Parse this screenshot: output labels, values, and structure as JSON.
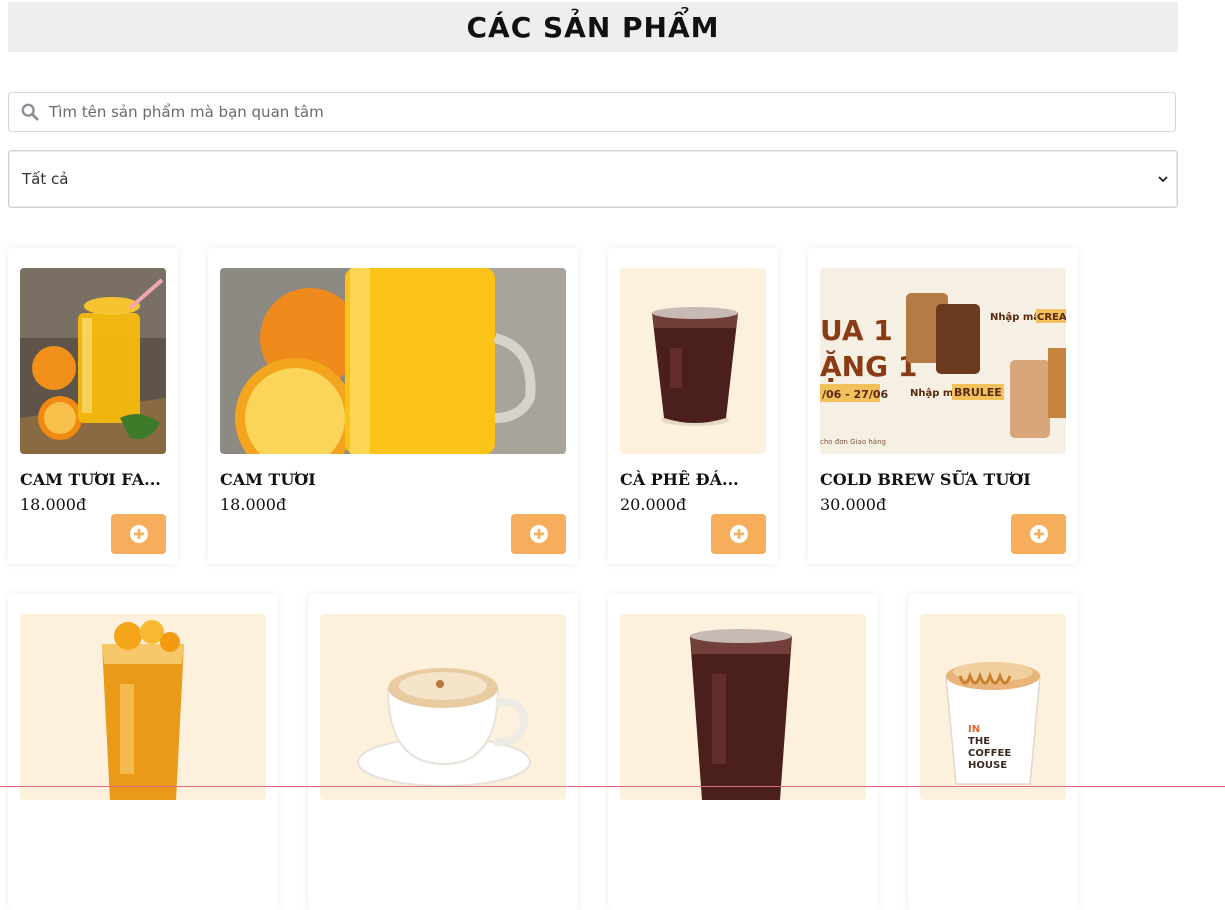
{
  "header": {
    "title": "CÁC SẢN PHẨM"
  },
  "search": {
    "placeholder": "Tìm tên sản phẩm mà bạn quan tâm",
    "icon": "search-icon"
  },
  "filter": {
    "selected": "Tất cả",
    "icon": "chevron-down-icon"
  },
  "colors": {
    "accent": "#f6ae5c",
    "title_bg": "#eeeeee",
    "image_bg": "#fdf0dc"
  },
  "products": [
    {
      "name": "CAM TƯƠI FA...",
      "price": "18.000đ"
    },
    {
      "name": "CAM TƯƠI",
      "price": "18.000đ"
    },
    {
      "name": "CÀ PHÊ ĐÁ...",
      "price": "20.000đ"
    },
    {
      "name": "COLD BREW SỮA TƯƠI",
      "price": "30.000đ"
    },
    {
      "name": "",
      "price": ""
    },
    {
      "name": "",
      "price": ""
    },
    {
      "name": "",
      "price": ""
    },
    {
      "name": "",
      "price": ""
    }
  ],
  "promo_image_text": {
    "line1": "UA 1",
    "line2": "ẶNG 1",
    "dates": "/06 - 27/06",
    "code_label_1": "Nhập mã:",
    "code_1": "CREA",
    "code_label_2": "Nhập mã:",
    "code_2": "BRULEE",
    "footnote": "cho đơn Giao hàng"
  },
  "cup_text": {
    "l1": "IN",
    "l2": "THE",
    "l3": "COFFEE",
    "l4": "HOUSE"
  }
}
